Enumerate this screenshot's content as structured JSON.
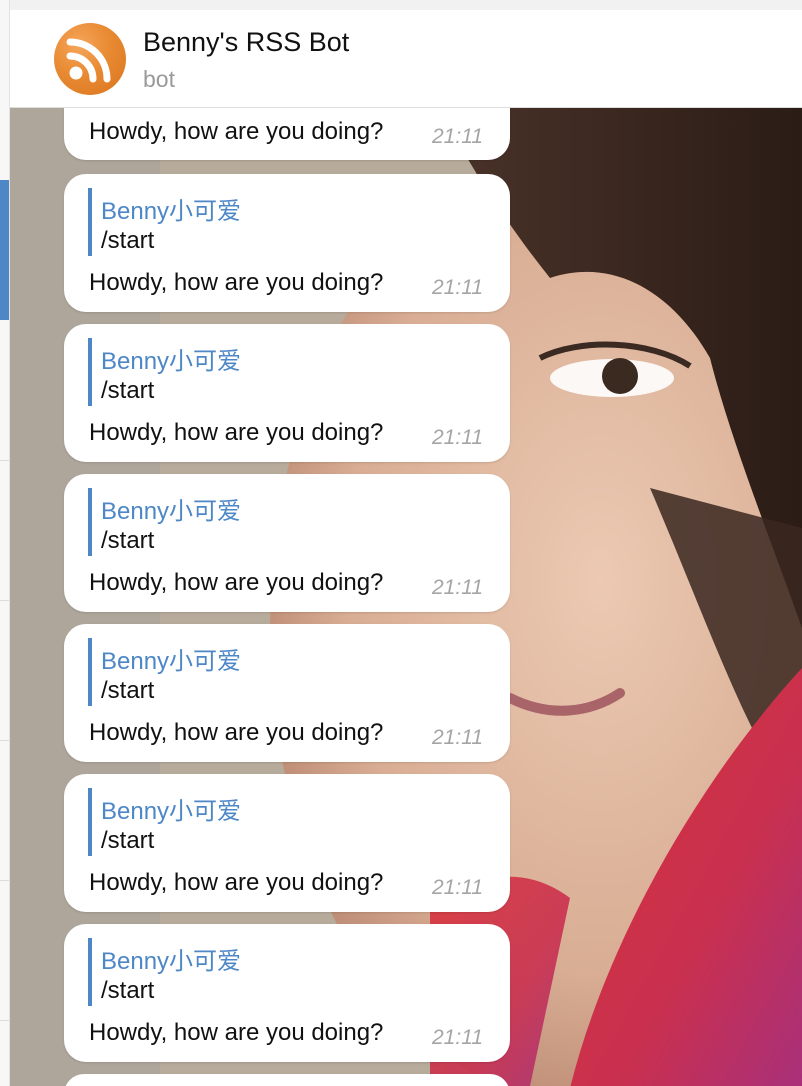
{
  "chat": {
    "title": "Benny's RSS Bot",
    "subtitle": "bot",
    "avatar_icon": "rss-icon",
    "accent_color": "#4d87c6",
    "avatar_color": "#e88a32"
  },
  "messages": [
    {
      "text": "Howdy, how are you doing?",
      "time": "21:11"
    },
    {
      "reply_author": "Benny小可爱",
      "reply_text": "/start",
      "text": "Howdy, how are you doing?",
      "time": "21:11"
    },
    {
      "reply_author": "Benny小可爱",
      "reply_text": "/start",
      "text": "Howdy, how are you doing?",
      "time": "21:11"
    },
    {
      "reply_author": "Benny小可爱",
      "reply_text": "/start",
      "text": "Howdy, how are you doing?",
      "time": "21:11"
    },
    {
      "reply_author": "Benny小可爱",
      "reply_text": "/start",
      "text": "Howdy, how are you doing?",
      "time": "21:11"
    },
    {
      "reply_author": "Benny小可爱",
      "reply_text": "/start",
      "text": "Howdy, how are you doing?",
      "time": "21:11"
    },
    {
      "reply_author": "Benny小可爱",
      "reply_text": "/start",
      "text": "Howdy, how are you doing?",
      "time": "21:11"
    }
  ]
}
